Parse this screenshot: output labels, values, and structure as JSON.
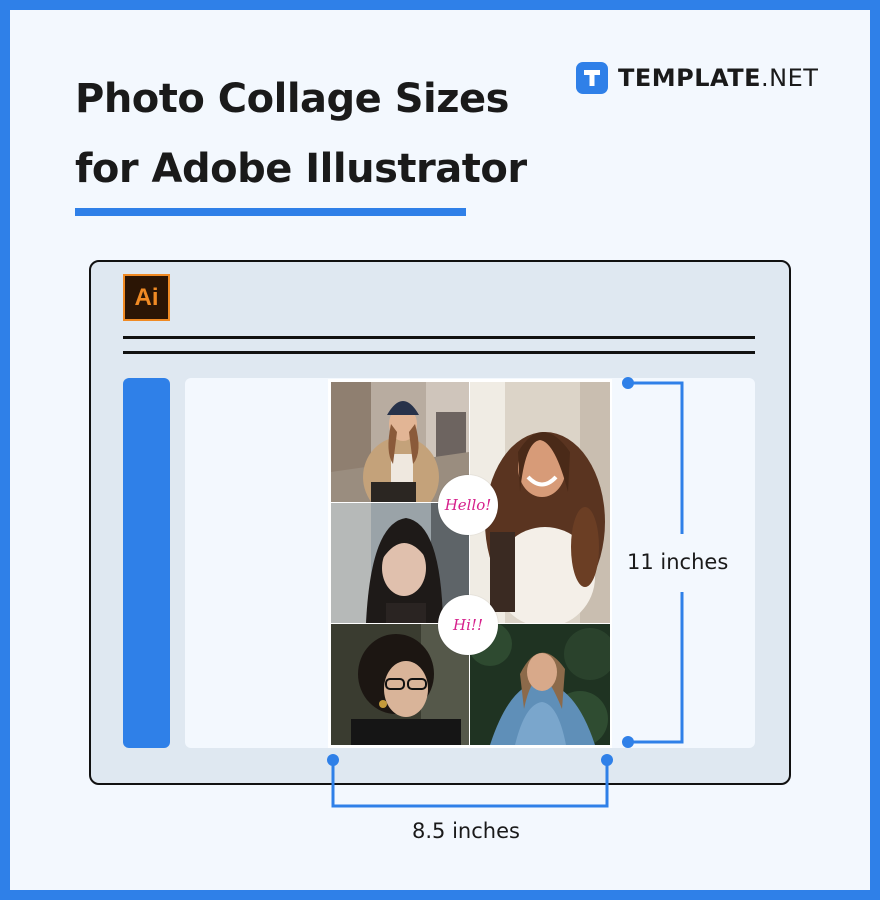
{
  "header": {
    "title_line1": "Photo Collage Sizes",
    "title_line2": "for Adobe Illustrator"
  },
  "brand": {
    "name_bold": "TEMPLATE",
    "name_suffix": ".NET",
    "logo_letter": "T"
  },
  "app": {
    "icon_text": "Ai"
  },
  "collage": {
    "stickers": [
      "Hello!",
      "Hi!!"
    ]
  },
  "dimensions": {
    "height_label": "11 inches",
    "width_label": "8.5 inches"
  },
  "colors": {
    "accent": "#2f80e8",
    "ai_orange": "#f08a24",
    "sticker_pink": "#d6208c"
  }
}
